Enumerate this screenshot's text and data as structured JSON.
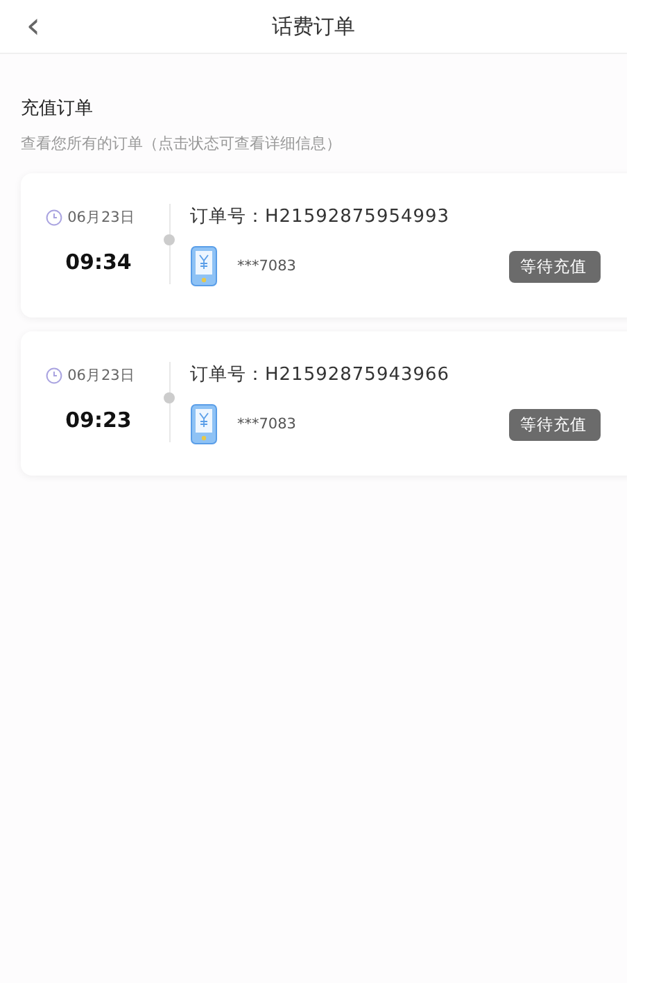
{
  "header": {
    "title": "话费订单",
    "back": "‹"
  },
  "section": {
    "title": "充值订单",
    "subtitle": "查看您所有的订单（点击状态可查看详细信息）"
  },
  "orders": [
    {
      "date": "06月23日",
      "time": "09:34",
      "order_label": "订单号：",
      "order_no": "H21592875954993",
      "phone": "***7083",
      "status": "等待充值"
    },
    {
      "date": "06月23日",
      "time": "09:23",
      "order_label": "订单号：",
      "order_no": "H21592875943966",
      "phone": "***7083",
      "status": "等待充值"
    }
  ]
}
